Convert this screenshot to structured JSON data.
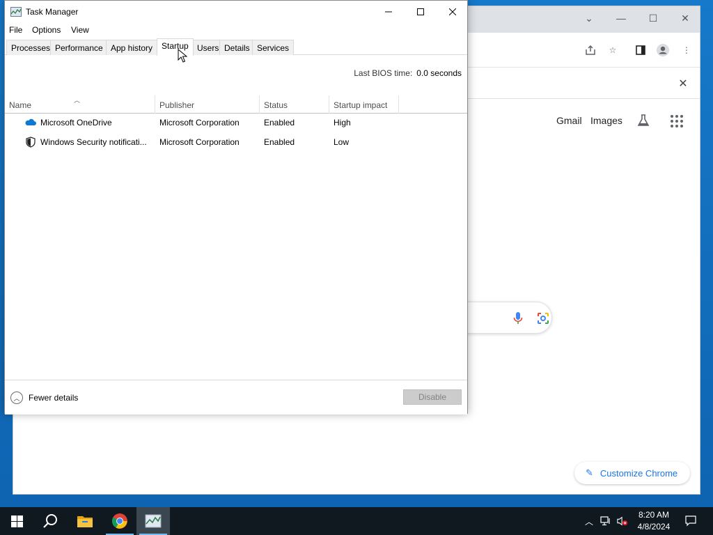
{
  "desktop": {},
  "chrome": {
    "links": {
      "gmail": "Gmail",
      "images": "Images"
    },
    "customize_label": "Customize Chrome"
  },
  "task_manager": {
    "title": "Task Manager",
    "menu": [
      "File",
      "Options",
      "View"
    ],
    "tabs": [
      "Processes",
      "Performance",
      "App history",
      "Startup",
      "Users",
      "Details",
      "Services"
    ],
    "active_tab": "Startup",
    "bios_label": "Last BIOS time:",
    "bios_value": "0.0 seconds",
    "columns": [
      "Name",
      "Publisher",
      "Status",
      "Startup impact"
    ],
    "rows": [
      {
        "icon": "onedrive-icon",
        "name": "Microsoft OneDrive",
        "publisher": "Microsoft Corporation",
        "status": "Enabled",
        "impact": "High"
      },
      {
        "icon": "shield-icon",
        "name": "Windows Security notificati...",
        "publisher": "Microsoft Corporation",
        "status": "Enabled",
        "impact": "Low"
      }
    ],
    "fewer_details_label": "Fewer details",
    "disable_label": "Disable"
  },
  "taskbar": {
    "apps": [
      "start-icon",
      "search-icon",
      "file-explorer-icon",
      "chrome-icon",
      "task-manager-icon"
    ],
    "clock_time": "8:20 AM",
    "clock_date": "4/8/2024"
  },
  "colors": {
    "desktop": "#1679c9",
    "taskbar": "#101820",
    "accent": "#1a73e8"
  }
}
